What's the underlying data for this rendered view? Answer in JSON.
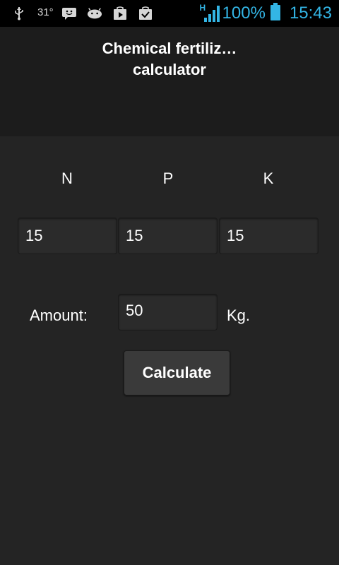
{
  "status_bar": {
    "temperature": "31°",
    "battery": "100%",
    "time": "15:43",
    "network_type": "H",
    "icons": [
      "usb-icon",
      "weather-icon",
      "messaging-icon",
      "android-debug-icon",
      "play-store-icon",
      "task-check-icon",
      "signal-icon",
      "battery-icon"
    ],
    "accent_color": "#33b5e5"
  },
  "title_bar": {
    "line1": "Chemical fertiliz…",
    "line2": "calculator"
  },
  "nutrients": {
    "labels": [
      "N",
      "P",
      "K"
    ],
    "values": [
      "15",
      "15",
      "15"
    ]
  },
  "amount": {
    "label": "Amount:",
    "value": "50",
    "unit": "Kg."
  },
  "calculate_button": {
    "label": "Calculate"
  }
}
